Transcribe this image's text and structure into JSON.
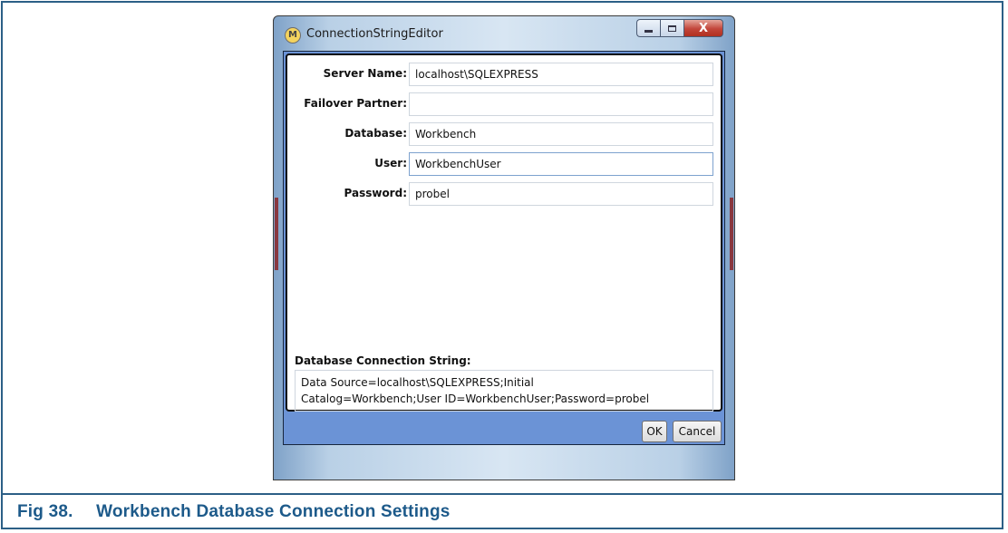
{
  "window": {
    "title": "ConnectionStringEditor",
    "icon": "app-icon-m",
    "icon_letter": "M",
    "close_glyph": "X"
  },
  "form": {
    "fields": [
      {
        "label": "Server Name:",
        "value": "localhost\\SQLEXPRESS"
      },
      {
        "label": "Failover Partner:",
        "value": ""
      },
      {
        "label": "Database:",
        "value": "Workbench"
      },
      {
        "label": "User:",
        "value": "WorkbenchUser"
      },
      {
        "label": "Password:",
        "value": "probel"
      }
    ],
    "connection_string_label": "Database Connection String:",
    "connection_string_line1": "Data Source=localhost\\SQLEXPRESS;Initial",
    "connection_string_line2": "Catalog=Workbench;User ID=WorkbenchUser;Password=probel"
  },
  "buttons": {
    "ok": "OK",
    "cancel": "Cancel"
  },
  "caption": {
    "number": "Fig 38.",
    "text": "Workbench Database Connection Settings"
  },
  "colors": {
    "caption": "#1d5a8a",
    "client_bg": "#6b93d6",
    "close_btn": "#c2453a"
  }
}
